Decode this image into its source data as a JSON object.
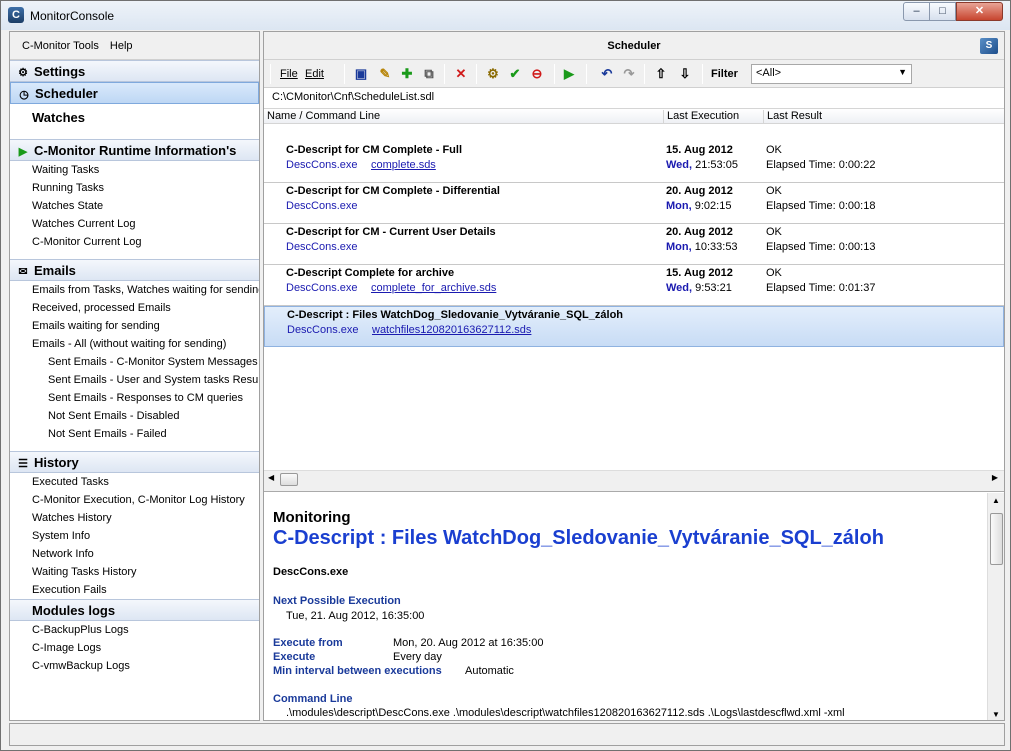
{
  "window": {
    "title": "MonitorConsole",
    "icon_glyph": "C",
    "min_glyph": "–",
    "max_glyph": "□",
    "close_glyph": "✕"
  },
  "menu": {
    "tools": "C-Monitor Tools",
    "help": "Help"
  },
  "left": {
    "settings": "Settings",
    "scheduler": "Scheduler",
    "watches": "Watches",
    "runtime": "C-Monitor Runtime Information's",
    "runtime_items": [
      "Waiting Tasks",
      "Running Tasks",
      "Watches State",
      "Watches Current Log",
      "C-Monitor Current Log"
    ],
    "emails": "Emails",
    "email_items": [
      "Emails from Tasks, Watches waiting for sending",
      "Received, processed Emails",
      "Emails waiting for sending",
      "Emails - All (without waiting for sending)"
    ],
    "email_sub_items": [
      "Sent Emails - C-Monitor System Messages",
      "Sent Emails - User and System tasks Results",
      "Sent Emails - Responses to CM queries",
      "Not Sent Emails - Disabled",
      "Not Sent Emails - Failed"
    ],
    "history": "History",
    "history_items": [
      "Executed Tasks",
      "C-Monitor Execution, C-Monitor Log History",
      "Watches History",
      "System Info",
      "Network Info",
      "Waiting Tasks History",
      "Execution Fails"
    ],
    "modules": "Modules logs",
    "module_items": [
      "C-BackupPlus Logs",
      "C-Image Logs",
      "C-vmwBackup Logs"
    ]
  },
  "right": {
    "title": "Scheduler",
    "toolbar": {
      "file": "File",
      "edit": "Edit",
      "filter_label": "Filter",
      "filter_value": "<All>"
    },
    "path": "C:\\CMonitor\\Cnf\\ScheduleList.sdl",
    "columns": [
      "Name / Command Line",
      "Last Execution",
      "Last Result"
    ],
    "rows": [
      {
        "name": "C-Descript for CM Complete - Full",
        "exe": "DescCons.exe",
        "arg": "complete.sds",
        "date": "15. Aug 2012",
        "day": "Wed,",
        "time": "21:53:05",
        "result": "OK",
        "elapsed": "Elapsed Time: 0:00:22"
      },
      {
        "name": "C-Descript for CM Complete - Differential",
        "exe": "DescCons.exe",
        "arg": "",
        "date": "20. Aug 2012",
        "day": "Mon,",
        "time": "9:02:15",
        "result": "OK",
        "elapsed": "Elapsed Time: 0:00:18"
      },
      {
        "name": "C-Descript for CM - Current User Details",
        "exe": "DescCons.exe",
        "arg": "",
        "date": "20. Aug 2012",
        "day": "Mon,",
        "time": "10:33:53",
        "result": "OK",
        "elapsed": "Elapsed Time: 0:00:13"
      },
      {
        "name": "C-Descript Complete for archive",
        "exe": "DescCons.exe",
        "arg": "complete_for_archive.sds",
        "date": "15. Aug 2012",
        "day": "Wed,",
        "time": "9:53:21",
        "result": "OK",
        "elapsed": "Elapsed Time: 0:01:37"
      },
      {
        "name": "C-Descript : Files WatchDog_Sledovanie_Vytváranie_SQL_záloh",
        "exe": "DescCons.exe",
        "arg": "watchfiles120820163627112.sds",
        "date": "",
        "day": "",
        "time": "",
        "result": "",
        "elapsed": ""
      }
    ],
    "detail": {
      "heading": "Monitoring",
      "name": "C-Descript : Files WatchDog_Sledovanie_Vytváranie_SQL_záloh",
      "exe": "DescCons.exe",
      "next_label": "Next Possible Execution",
      "next_value": "Tue, 21. Aug 2012, 16:35:00",
      "from_label": "Execute from",
      "from_value": "Mon, 20. Aug 2012 at 16:35:00",
      "execute_label": "Execute",
      "execute_value": "Every day",
      "interval_label": "Min interval between executions",
      "interval_value": "Automatic",
      "cmd_label": "Command Line",
      "cmd_value": ".\\modules\\descript\\DescCons.exe .\\modules\\descript\\watchfiles120820163627112.sds .\\Logs\\lastdescflwd.xml -xml"
    }
  },
  "colors": {
    "accent_blue": "#1a3fd0",
    "link_blue": "#1a1ab0",
    "selection": "#c8dcf5"
  }
}
